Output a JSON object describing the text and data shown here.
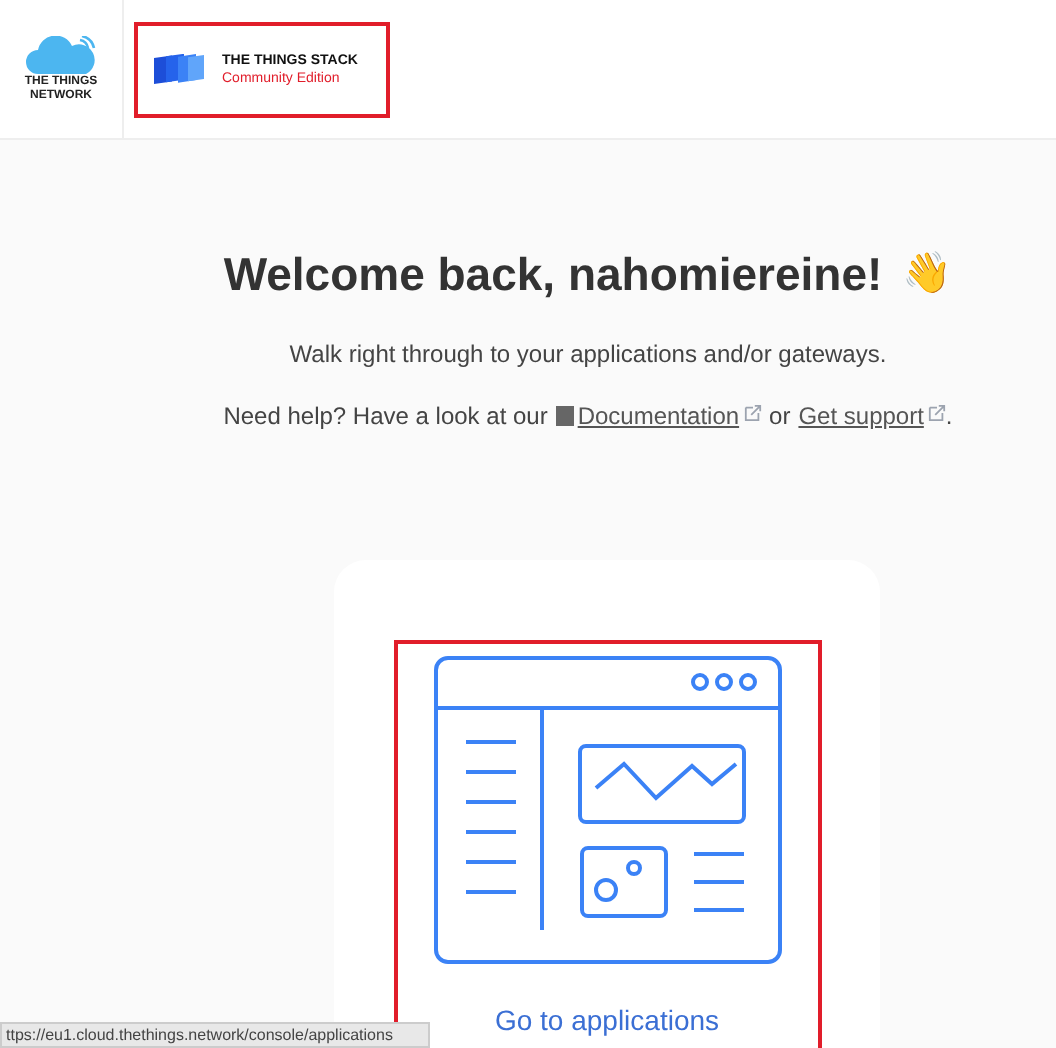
{
  "header": {
    "network_logo": "THE THINGS NETWORK",
    "stack_logo": {
      "title": "THE THINGS STACK",
      "subtitle": "Community Edition",
      "highlighted": true
    }
  },
  "welcome": {
    "title": "Welcome back, nahomiereine!",
    "emoji": "👋",
    "subtitle": "Walk right through to your applications and/or gateways.",
    "help": {
      "prefix": "Need help? Have a look at our",
      "doc_link": "Documentation",
      "joiner": "or",
      "support_link": "Get support",
      "suffix": "."
    }
  },
  "card": {
    "label": "Go to applications",
    "highlighted": true
  },
  "status_bar": {
    "url": "ttps://eu1.cloud.thethings.network/console/applications"
  }
}
